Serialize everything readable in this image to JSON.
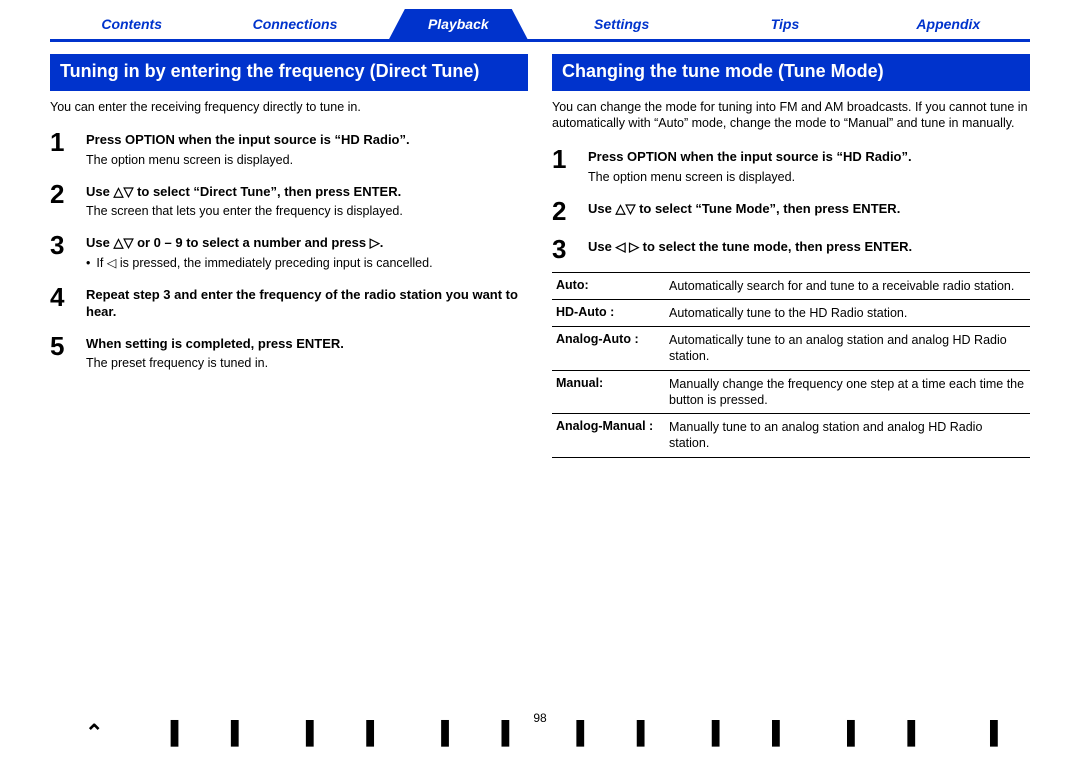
{
  "nav": {
    "items": [
      "Contents",
      "Connections",
      "Playback",
      "Settings",
      "Tips",
      "Appendix"
    ],
    "active_index": 2
  },
  "left": {
    "header": "Tuning in by entering the frequency (Direct Tune)",
    "intro": "You can enter the receiving frequency directly to tune in.",
    "steps": [
      {
        "num": "1",
        "title": "Press OPTION when the input source is “HD Radio”.",
        "desc": "The option menu screen is displayed."
      },
      {
        "num": "2",
        "title": "Use △▽ to select “Direct Tune”, then press ENTER.",
        "desc": "The screen that lets you enter the frequency is displayed."
      },
      {
        "num": "3",
        "title": "Use △▽ or 0 – 9 to select a number and press ▷.",
        "bullet": "If ◁ is pressed, the immediately preceding input is cancelled."
      },
      {
        "num": "4",
        "title": "Repeat step 3 and enter the frequency of the radio station you want to hear."
      },
      {
        "num": "5",
        "title": "When setting is completed, press ENTER.",
        "desc": "The preset frequency is tuned in."
      }
    ]
  },
  "right": {
    "header": "Changing the tune mode (Tune Mode)",
    "intro": "You can change the mode for tuning into FM and AM broadcasts. If you cannot tune in automatically with “Auto” mode, change the mode to “Manual” and tune in manually.",
    "steps": [
      {
        "num": "1",
        "title": "Press OPTION when the input source is “HD Radio”.",
        "desc": "The option menu screen is displayed."
      },
      {
        "num": "2",
        "title": "Use △▽ to select “Tune Mode”, then press ENTER."
      },
      {
        "num": "3",
        "title": "Use ◁ ▷ to select the tune mode, then press ENTER."
      }
    ],
    "modes": [
      {
        "label": "Auto:",
        "desc": "Automatically search for and tune to a receivable radio station."
      },
      {
        "label": "HD-Auto :",
        "desc": "Automatically tune to the HD Radio station."
      },
      {
        "label": "Analog-Auto :",
        "desc": "Automatically tune to an analog station and analog HD Radio station."
      },
      {
        "label": "Manual:",
        "desc": "Manually change the frequency one step at a time each time the button is pressed."
      },
      {
        "label": "Analog-Manual :",
        "desc": "Manually tune to an analog station and analog HD Radio station."
      }
    ]
  },
  "footer": {
    "page": "98"
  }
}
